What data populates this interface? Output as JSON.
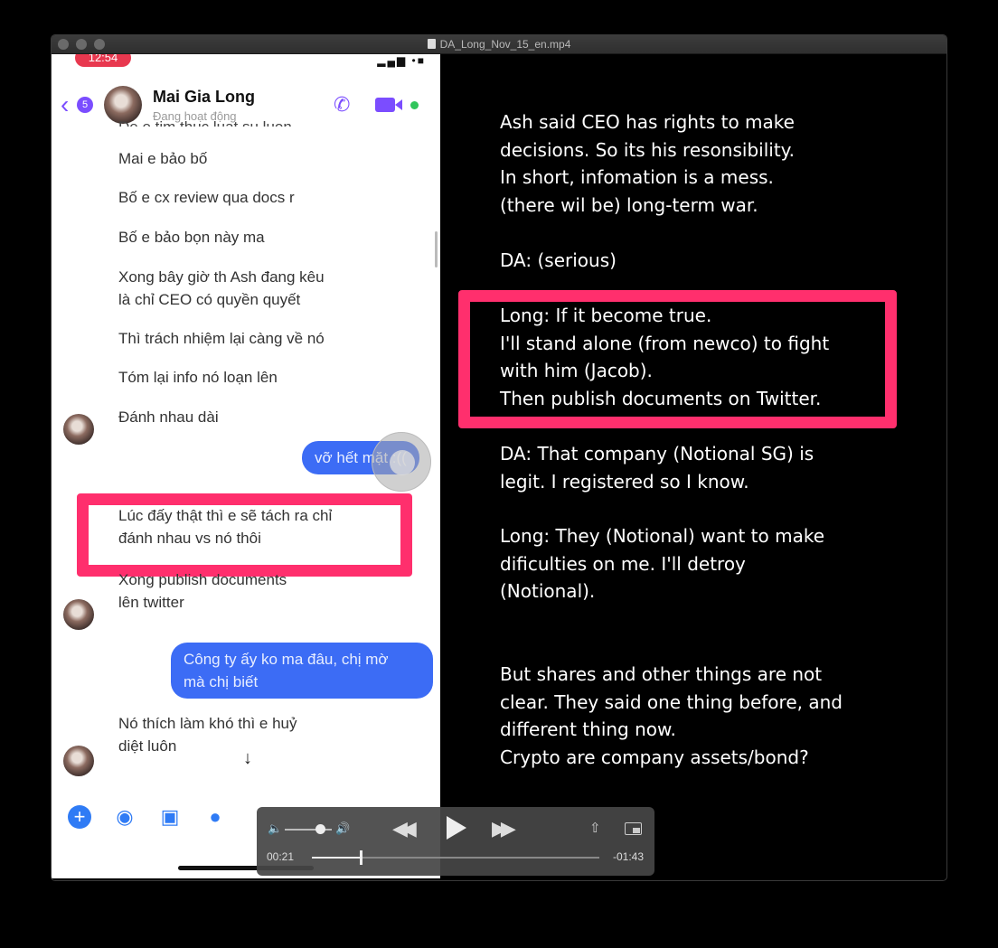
{
  "window": {
    "title": "DA_Long_Nov_15_en.mp4"
  },
  "phone": {
    "status_time": "12:54",
    "status_icons": "▂▄▆ •■",
    "header": {
      "back_count": "5",
      "contact_name": "Mai Gia Long",
      "contact_status": "Đang hoạt động"
    },
    "messages": [
      "Mai e bảo bố",
      "Bố e cx review qua docs r",
      "Bố e bảo bọn này ma",
      "Xong bây giờ th Ash đang kêu\nlà chỉ CEO có quyền quyết",
      "Thì trách nhiệm lại càng về nó",
      "Tóm lại info nó loạn lên",
      "Đánh nhau dài",
      "Lúc đấy thật thì e sẽ tách ra chỉ\nđánh nhau vs nó thôi",
      "Xong publish documents\nlên twitter",
      "Nó thích làm khó thì e huỷ\ndiệt luôn"
    ],
    "cut_message": "De e tim thuc luat su luon.",
    "outgoing": [
      "vỡ hết mặt :((",
      "Công ty ấy ko ma đâu, chị mờ\nmà chị biết"
    ]
  },
  "slide": {
    "block1": "Ash said CEO has rights to make\ndecisions. So its his resonsibility.\nIn short, infomation is a mess.\n(there wil be) long-term war.",
    "block2": "DA: (serious)",
    "block3": "Long: If it become true.\nI'll stand alone (from newco) to fight\nwith him (Jacob).\nThen publish documents on Twitter.",
    "block4": "DA: That company (Notional SG) is\nlegit. I registered so I know.",
    "block5": "Long: They (Notional) want to make\ndificulties on me. I'll detroy\n(Notional).",
    "block6": "But shares and other things are not\nclear. They said one thing before, and\ndifferent thing now.\nCrypto are company assets/bond?"
  },
  "player": {
    "elapsed": "00:21",
    "remaining": "-01:43",
    "progress": 0.17,
    "volume": 0.75
  },
  "colors": {
    "highlight": "#ff2f6d",
    "messenger_purple": "#7b4dff",
    "outgoing_bubble": "#3c6cf5"
  }
}
